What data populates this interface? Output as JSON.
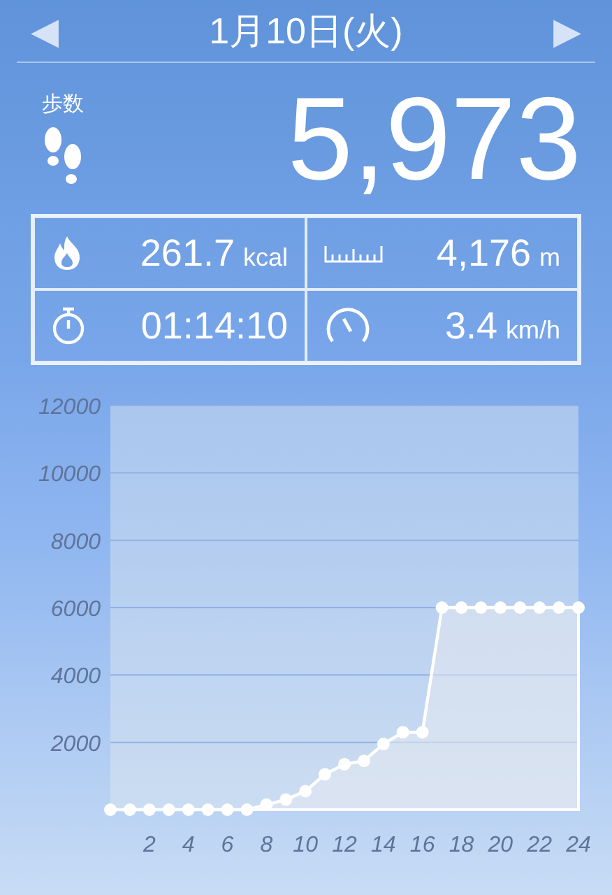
{
  "header": {
    "date": "1月10日(火)",
    "prev": "◀",
    "next": "▶"
  },
  "steps": {
    "label": "歩数",
    "value": "5,973"
  },
  "stats": [
    {
      "kind": "calories",
      "value": "261.7",
      "unit": "kcal"
    },
    {
      "kind": "distance",
      "value": "4,176",
      "unit": "m"
    },
    {
      "kind": "time",
      "value": "01:14:10"
    },
    {
      "kind": "speed",
      "value": "3.4",
      "unit": "km/h"
    }
  ],
  "chart": {
    "chart_data": {
      "type": "area",
      "x": [
        0,
        1,
        2,
        3,
        4,
        5,
        6,
        7,
        8,
        9,
        10,
        11,
        12,
        13,
        14,
        15,
        16,
        17,
        18,
        19,
        20,
        21,
        22,
        23,
        24
      ],
      "series": [
        {
          "color": "#ffffff",
          "values": [
            0,
            0,
            0,
            0,
            0,
            0,
            0,
            0,
            150,
            300,
            550,
            1050,
            1350,
            1450,
            1950,
            2300,
            2300,
            6000,
            6000,
            6000,
            6000,
            6000,
            6000,
            6000,
            6000
          ]
        }
      ],
      "grid": true,
      "xlim": [
        0,
        24
      ],
      "ylim": [
        0,
        12000
      ],
      "xticks": [
        2,
        4,
        6,
        8,
        10,
        12,
        14,
        16,
        18,
        20,
        22,
        24
      ],
      "yticks": [
        2000,
        4000,
        6000,
        8000,
        10000,
        12000
      ]
    }
  }
}
